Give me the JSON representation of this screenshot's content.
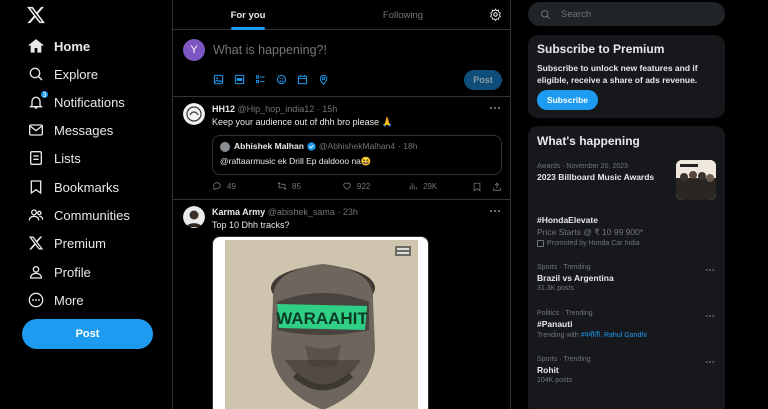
{
  "nav": {
    "items": [
      {
        "label": "Home",
        "icon": "home-icon",
        "active": true
      },
      {
        "label": "Explore",
        "icon": "search-icon"
      },
      {
        "label": "Notifications",
        "icon": "bell-icon",
        "badge": "3"
      },
      {
        "label": "Messages",
        "icon": "mail-icon"
      },
      {
        "label": "Lists",
        "icon": "list-icon"
      },
      {
        "label": "Bookmarks",
        "icon": "bookmark-icon"
      },
      {
        "label": "Communities",
        "icon": "people-icon"
      },
      {
        "label": "Premium",
        "icon": "x-logo-icon"
      },
      {
        "label": "Profile",
        "icon": "person-icon"
      },
      {
        "label": "More",
        "icon": "more-circle-icon"
      }
    ],
    "post_button": "Post"
  },
  "timeline": {
    "tabs": [
      {
        "label": "For you",
        "active": true
      },
      {
        "label": "Following",
        "active": false
      }
    ],
    "compose": {
      "avatar_letter": "Y",
      "placeholder": "What is happening?!",
      "post_button": "Post"
    },
    "tweets": [
      {
        "name": "HH12",
        "handle": "@Hip_hop_india12",
        "time": "· 15h",
        "text": "Keep your audience out of dhh bro please 🙏",
        "quote": {
          "name": "Abhishek Malhan",
          "handle": "@AbhishekMalhan4",
          "time": "· 18h",
          "text": "@raftaarmusic ek Drill Ep daldooo na😆"
        },
        "stats": {
          "replies": "49",
          "reposts": "85",
          "likes": "922",
          "views": "29K"
        }
      },
      {
        "name": "Karma Army",
        "handle": "@abishek_sama",
        "time": "· 23h",
        "text": "Top 10 Dhh tracks?",
        "media_text": "WARAAHIT"
      }
    ]
  },
  "sidebar_right": {
    "search_placeholder": "Search",
    "premium": {
      "title": "Subscribe to Premium",
      "description": "Subscribe to unlock new features and if eligible, receive a share of ads revenue.",
      "button": "Subscribe"
    },
    "happening": {
      "title": "What's happening",
      "trends": [
        {
          "meta": "Awards · November 20, 2023",
          "title": "2023 Billboard Music Awards"
        },
        {
          "title": "#HondaElevate",
          "price": "Price Starts @ ₹ 10 99 900*",
          "promo": "Promoted by Honda Car India"
        },
        {
          "meta": "Sports · Trending",
          "title": "Brazil vs Argentina",
          "sub": "31.3K posts"
        },
        {
          "meta": "Politics · Trending",
          "title": "#Panauti",
          "sub_prefix": "Trending with ",
          "links": "#पनौती, Rahul Gandhi"
        },
        {
          "meta": "Sports · Trending",
          "title": "Rohit",
          "sub": "104K posts"
        }
      ]
    }
  },
  "colors": {
    "accent": "#1d9bf0",
    "background": "#000000",
    "card": "#16181c",
    "border": "#2f3336",
    "muted": "#71767b"
  }
}
